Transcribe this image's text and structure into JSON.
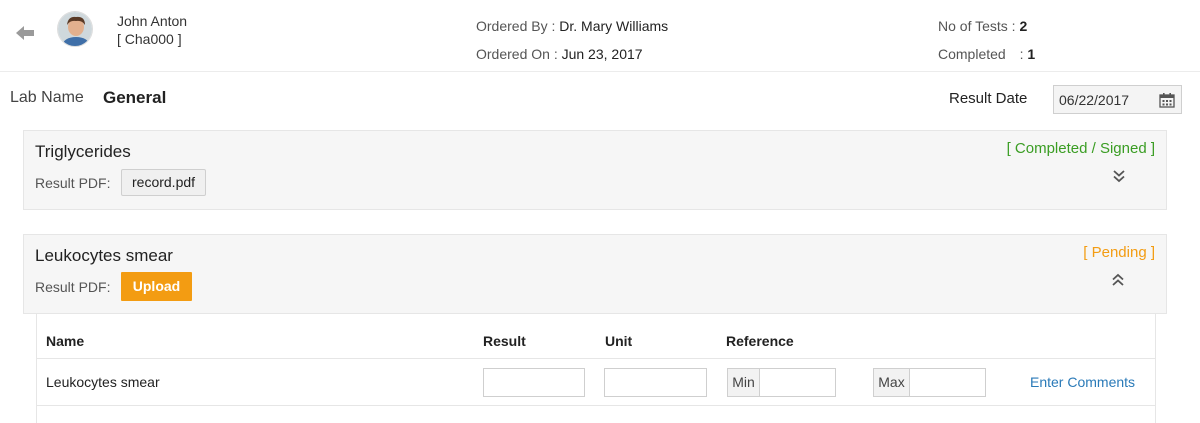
{
  "patient": {
    "name": "John Anton",
    "id": "[ Cha000 ]"
  },
  "order": {
    "ordered_by_label": "Ordered By :",
    "ordered_by": "Dr. Mary Williams",
    "ordered_on_label": "Ordered On :",
    "ordered_on": "Jun 23, 2017"
  },
  "tests": {
    "count_label": "No of Tests :",
    "count": "2",
    "completed_label": "Completed",
    "completed_sep": ":",
    "completed": "1"
  },
  "lab": {
    "label": "Lab Name",
    "name": "General",
    "result_date_label": "Result Date",
    "result_date": "06/22/2017"
  },
  "cards": [
    {
      "title": "Triglycerides",
      "pdf_label": "Result PDF:",
      "file": "record.pdf",
      "status": "[ Completed / Signed ]"
    },
    {
      "title": "Leukocytes smear",
      "pdf_label": "Result PDF:",
      "upload_label": "Upload",
      "status": "[ Pending ]"
    }
  ],
  "table": {
    "headers": [
      "Name",
      "Result",
      "Unit",
      "Reference"
    ],
    "rows": [
      {
        "name": "Leukocytes smear",
        "min_label": "Min",
        "max_label": "Max",
        "comments_link": "Enter Comments"
      }
    ]
  },
  "colors": {
    "completed": "#3a9d23",
    "pending": "#f39c12",
    "link": "#2a7ab8"
  },
  "icons": [
    "back-arrow-icon",
    "calendar-icon",
    "chevron-double-down-icon",
    "chevron-double-up-icon"
  ]
}
